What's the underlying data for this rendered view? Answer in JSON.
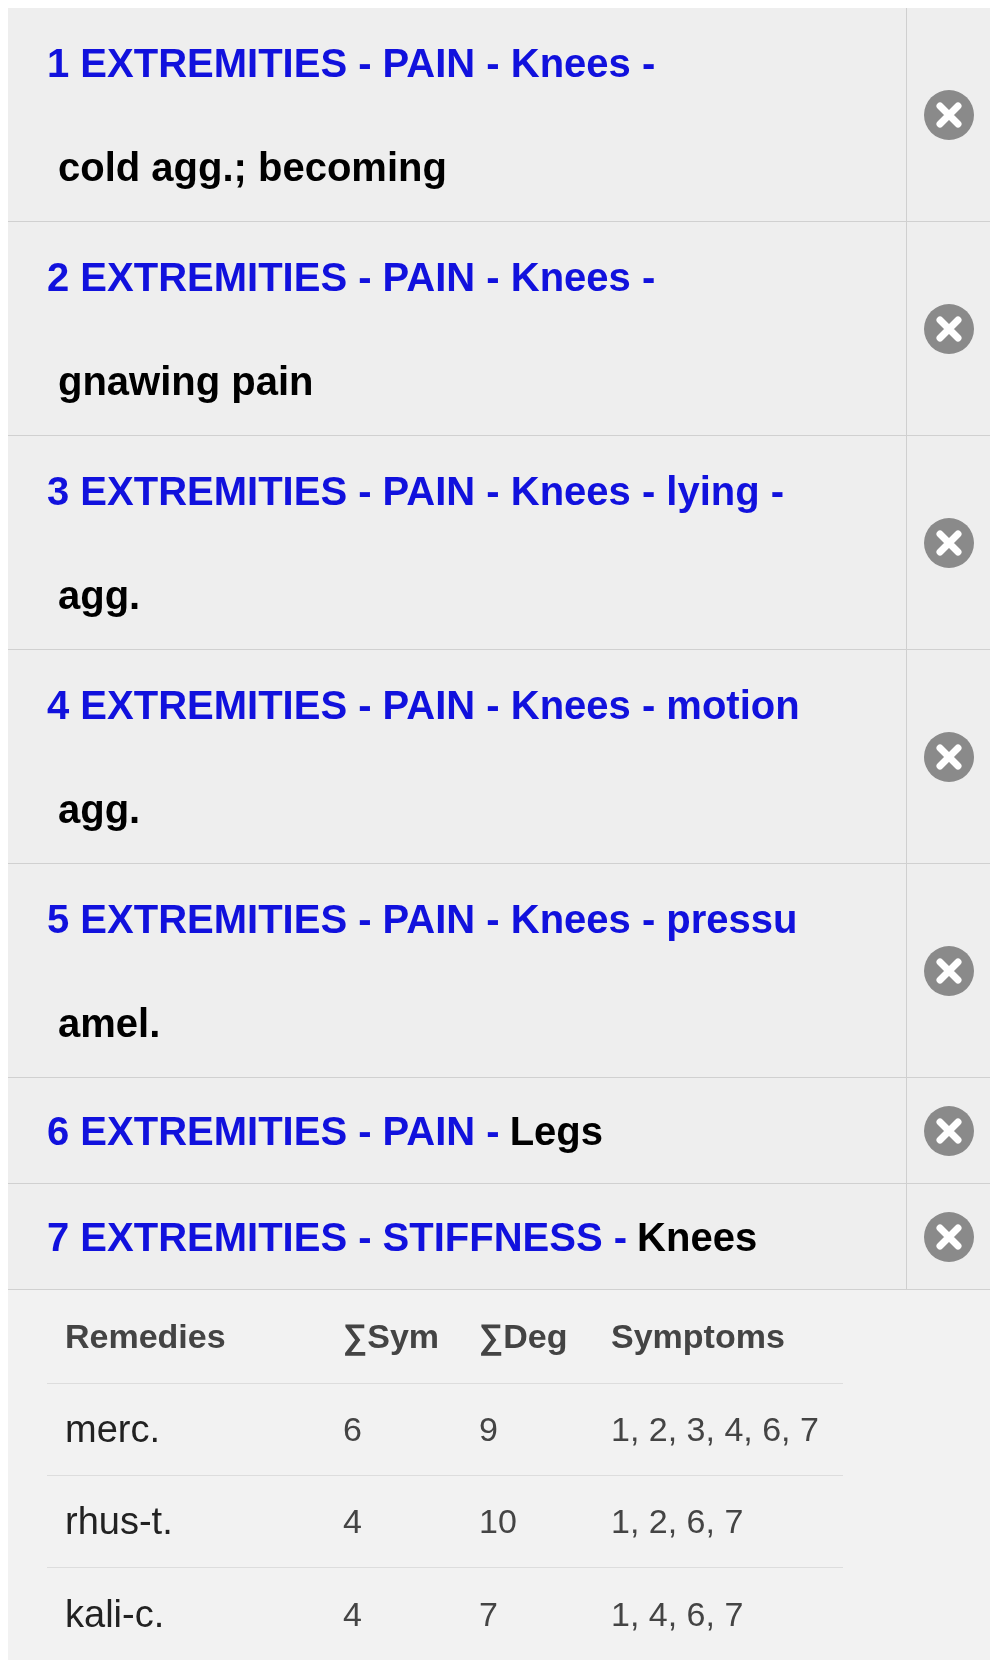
{
  "symptoms": [
    {
      "kind": "two_line",
      "path": "1 EXTREMITIES - PAIN - Knees -",
      "detail": "cold agg.; becoming"
    },
    {
      "kind": "two_line",
      "path": "2 EXTREMITIES - PAIN - Knees -",
      "detail": "gnawing pain"
    },
    {
      "kind": "two_line",
      "path": "3 EXTREMITIES - PAIN - Knees - lying -",
      "detail": "agg."
    },
    {
      "kind": "two_line",
      "path": "4 EXTREMITIES - PAIN - Knees - motion",
      "detail": "agg."
    },
    {
      "kind": "two_line",
      "path": "5 EXTREMITIES - PAIN - Knees - pressu",
      "detail": "amel."
    },
    {
      "kind": "one_line",
      "path": "6 EXTREMITIES - PAIN -",
      "detail": "Legs"
    },
    {
      "kind": "one_line",
      "path": "7 EXTREMITIES - STIFFNESS -",
      "detail": "Knees"
    }
  ],
  "table": {
    "columns": [
      "Remedies",
      "∑Sym",
      "∑Deg",
      "Symptoms"
    ],
    "rows": [
      [
        "merc.",
        "6",
        "9",
        "1, 2, 3, 4, 6, 7"
      ],
      [
        "rhus-t.",
        "4",
        "10",
        "1, 2, 6, 7"
      ],
      [
        "kali-c.",
        "4",
        "7",
        "1, 4, 6, 7"
      ]
    ]
  }
}
